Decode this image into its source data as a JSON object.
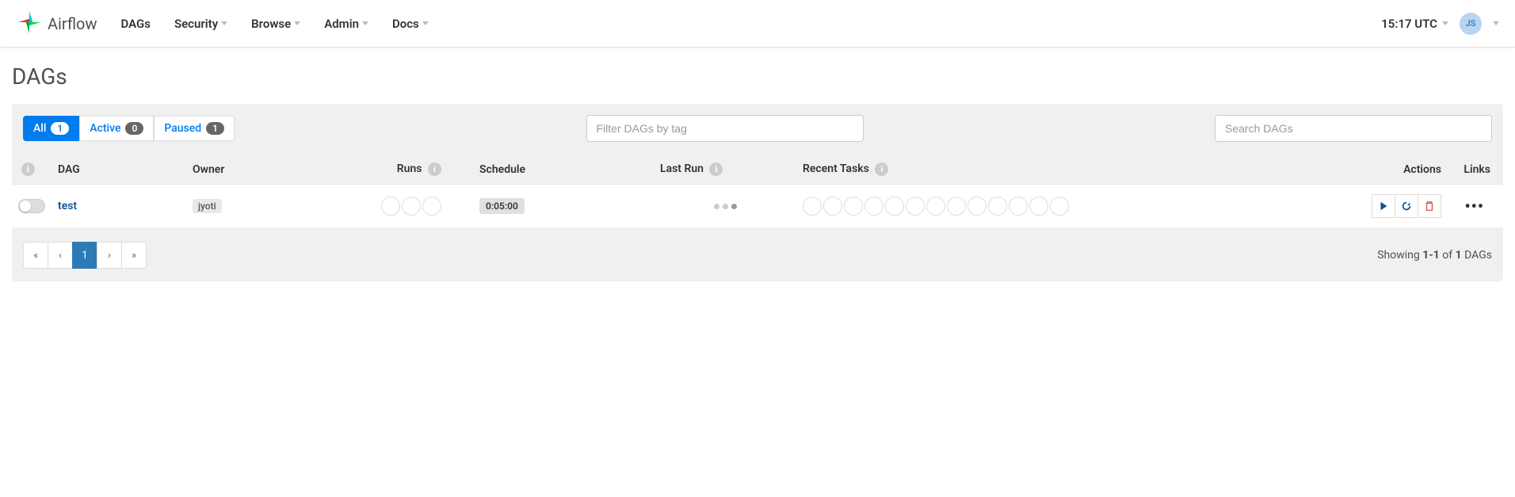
{
  "brand": {
    "name": "Airflow"
  },
  "nav": {
    "dags": "DAGs",
    "security": "Security",
    "browse": "Browse",
    "admin": "Admin",
    "docs": "Docs"
  },
  "header": {
    "time": "15:17 UTC",
    "user_initials": "JS"
  },
  "page": {
    "title": "DAGs"
  },
  "filters": {
    "all": {
      "label": "All",
      "count": "1"
    },
    "active": {
      "label": "Active",
      "count": "0"
    },
    "paused": {
      "label": "Paused",
      "count": "1"
    },
    "tag_placeholder": "Filter DAGs by tag",
    "search_placeholder": "Search DAGs"
  },
  "columns": {
    "dag": "DAG",
    "owner": "Owner",
    "runs": "Runs",
    "schedule": "Schedule",
    "last_run": "Last Run",
    "recent_tasks": "Recent Tasks",
    "actions": "Actions",
    "links": "Links"
  },
  "rows": [
    {
      "name": "test",
      "owner": "jyoti",
      "schedule": "0:05:00"
    }
  ],
  "pagination": {
    "first": "«",
    "prev": "‹",
    "page1": "1",
    "next": "›",
    "last": "»",
    "showing_prefix": "Showing ",
    "showing_range": "1-1",
    "showing_of": " of ",
    "showing_total": "1",
    "showing_suffix": " DAGs"
  }
}
